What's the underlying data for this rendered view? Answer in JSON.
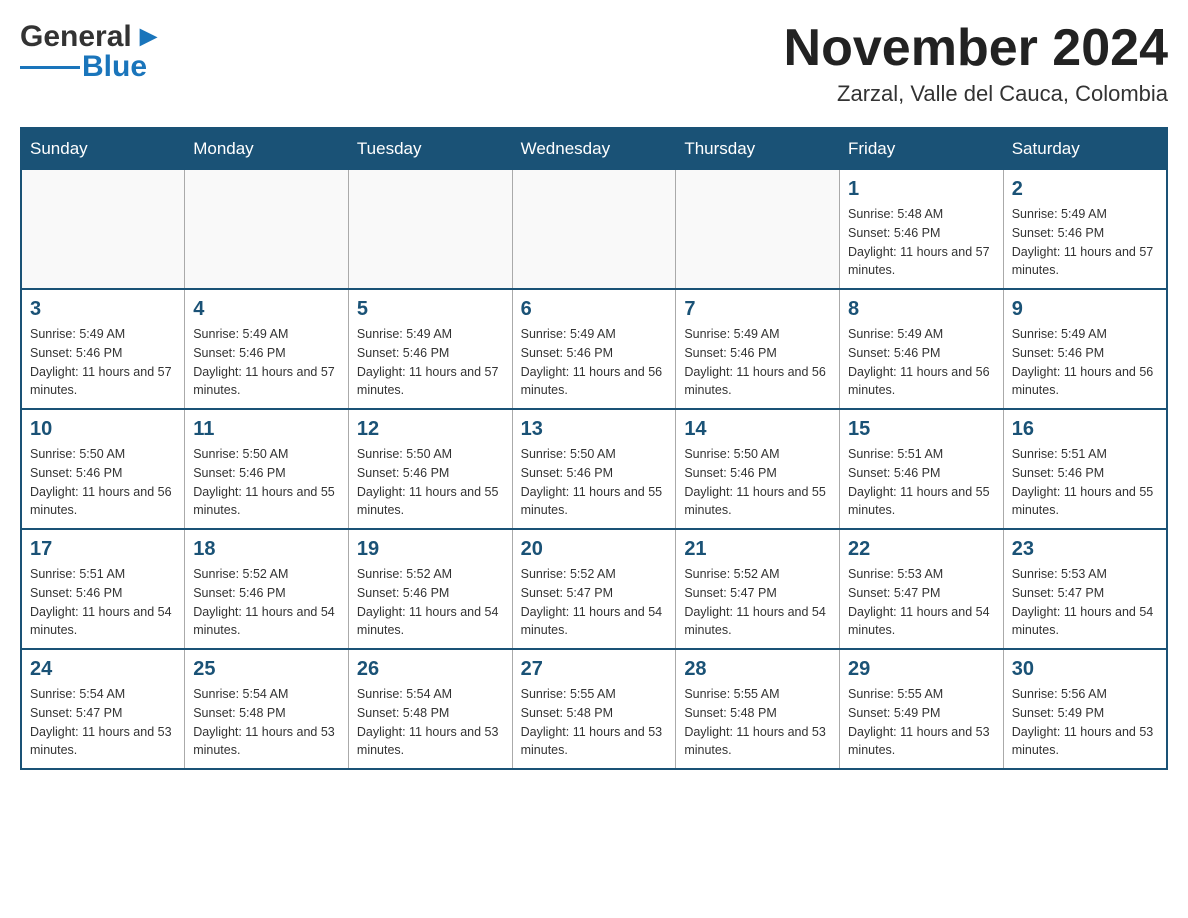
{
  "header": {
    "logo_general": "General",
    "logo_blue": "Blue",
    "month_title": "November 2024",
    "location": "Zarzal, Valle del Cauca, Colombia"
  },
  "days_of_week": [
    "Sunday",
    "Monday",
    "Tuesday",
    "Wednesday",
    "Thursday",
    "Friday",
    "Saturday"
  ],
  "weeks": [
    [
      {
        "day": "",
        "info": ""
      },
      {
        "day": "",
        "info": ""
      },
      {
        "day": "",
        "info": ""
      },
      {
        "day": "",
        "info": ""
      },
      {
        "day": "",
        "info": ""
      },
      {
        "day": "1",
        "info": "Sunrise: 5:48 AM\nSunset: 5:46 PM\nDaylight: 11 hours and 57 minutes."
      },
      {
        "day": "2",
        "info": "Sunrise: 5:49 AM\nSunset: 5:46 PM\nDaylight: 11 hours and 57 minutes."
      }
    ],
    [
      {
        "day": "3",
        "info": "Sunrise: 5:49 AM\nSunset: 5:46 PM\nDaylight: 11 hours and 57 minutes."
      },
      {
        "day": "4",
        "info": "Sunrise: 5:49 AM\nSunset: 5:46 PM\nDaylight: 11 hours and 57 minutes."
      },
      {
        "day": "5",
        "info": "Sunrise: 5:49 AM\nSunset: 5:46 PM\nDaylight: 11 hours and 57 minutes."
      },
      {
        "day": "6",
        "info": "Sunrise: 5:49 AM\nSunset: 5:46 PM\nDaylight: 11 hours and 56 minutes."
      },
      {
        "day": "7",
        "info": "Sunrise: 5:49 AM\nSunset: 5:46 PM\nDaylight: 11 hours and 56 minutes."
      },
      {
        "day": "8",
        "info": "Sunrise: 5:49 AM\nSunset: 5:46 PM\nDaylight: 11 hours and 56 minutes."
      },
      {
        "day": "9",
        "info": "Sunrise: 5:49 AM\nSunset: 5:46 PM\nDaylight: 11 hours and 56 minutes."
      }
    ],
    [
      {
        "day": "10",
        "info": "Sunrise: 5:50 AM\nSunset: 5:46 PM\nDaylight: 11 hours and 56 minutes."
      },
      {
        "day": "11",
        "info": "Sunrise: 5:50 AM\nSunset: 5:46 PM\nDaylight: 11 hours and 55 minutes."
      },
      {
        "day": "12",
        "info": "Sunrise: 5:50 AM\nSunset: 5:46 PM\nDaylight: 11 hours and 55 minutes."
      },
      {
        "day": "13",
        "info": "Sunrise: 5:50 AM\nSunset: 5:46 PM\nDaylight: 11 hours and 55 minutes."
      },
      {
        "day": "14",
        "info": "Sunrise: 5:50 AM\nSunset: 5:46 PM\nDaylight: 11 hours and 55 minutes."
      },
      {
        "day": "15",
        "info": "Sunrise: 5:51 AM\nSunset: 5:46 PM\nDaylight: 11 hours and 55 minutes."
      },
      {
        "day": "16",
        "info": "Sunrise: 5:51 AM\nSunset: 5:46 PM\nDaylight: 11 hours and 55 minutes."
      }
    ],
    [
      {
        "day": "17",
        "info": "Sunrise: 5:51 AM\nSunset: 5:46 PM\nDaylight: 11 hours and 54 minutes."
      },
      {
        "day": "18",
        "info": "Sunrise: 5:52 AM\nSunset: 5:46 PM\nDaylight: 11 hours and 54 minutes."
      },
      {
        "day": "19",
        "info": "Sunrise: 5:52 AM\nSunset: 5:46 PM\nDaylight: 11 hours and 54 minutes."
      },
      {
        "day": "20",
        "info": "Sunrise: 5:52 AM\nSunset: 5:47 PM\nDaylight: 11 hours and 54 minutes."
      },
      {
        "day": "21",
        "info": "Sunrise: 5:52 AM\nSunset: 5:47 PM\nDaylight: 11 hours and 54 minutes."
      },
      {
        "day": "22",
        "info": "Sunrise: 5:53 AM\nSunset: 5:47 PM\nDaylight: 11 hours and 54 minutes."
      },
      {
        "day": "23",
        "info": "Sunrise: 5:53 AM\nSunset: 5:47 PM\nDaylight: 11 hours and 54 minutes."
      }
    ],
    [
      {
        "day": "24",
        "info": "Sunrise: 5:54 AM\nSunset: 5:47 PM\nDaylight: 11 hours and 53 minutes."
      },
      {
        "day": "25",
        "info": "Sunrise: 5:54 AM\nSunset: 5:48 PM\nDaylight: 11 hours and 53 minutes."
      },
      {
        "day": "26",
        "info": "Sunrise: 5:54 AM\nSunset: 5:48 PM\nDaylight: 11 hours and 53 minutes."
      },
      {
        "day": "27",
        "info": "Sunrise: 5:55 AM\nSunset: 5:48 PM\nDaylight: 11 hours and 53 minutes."
      },
      {
        "day": "28",
        "info": "Sunrise: 5:55 AM\nSunset: 5:48 PM\nDaylight: 11 hours and 53 minutes."
      },
      {
        "day": "29",
        "info": "Sunrise: 5:55 AM\nSunset: 5:49 PM\nDaylight: 11 hours and 53 minutes."
      },
      {
        "day": "30",
        "info": "Sunrise: 5:56 AM\nSunset: 5:49 PM\nDaylight: 11 hours and 53 minutes."
      }
    ]
  ]
}
